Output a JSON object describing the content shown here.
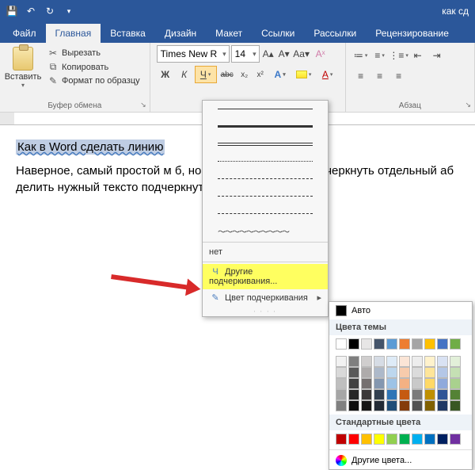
{
  "titlebar": {
    "doc_title": "как сд"
  },
  "tabs": {
    "file": "Файл",
    "home": "Главная",
    "insert": "Вставка",
    "design": "Дизайн",
    "layout": "Макет",
    "references": "Ссылки",
    "mailings": "Рассылки",
    "review": "Рецензирование"
  },
  "ribbon": {
    "clipboard": {
      "label": "Буфер обмена",
      "paste": "Вставить",
      "cut": "Вырезать",
      "copy": "Копировать",
      "format_painter": "Формат по образцу"
    },
    "font": {
      "name": "Times New R",
      "size": "14",
      "bold": "Ж",
      "italic": "К",
      "underline": "Ч",
      "strike": "abc",
      "sub": "x₂",
      "sup": "x²"
    },
    "paragraph": {
      "label": "Абзац"
    }
  },
  "document": {
    "title_sel": "Как в Word сделать линию",
    "para1": "Наверное, самый простой м                                          б, но все же включен м подчеркнуть отдельный аб                                          делить нужный тексто подчеркнутую букву ",
    "para1_end": "."
  },
  "underline_menu": {
    "none": "нет",
    "more": "Другие подчеркивания...",
    "color": "Цвет подчеркивания"
  },
  "color_panel": {
    "auto": "Авто",
    "theme": "Цвета темы",
    "standard": "Стандартные цвета",
    "more": "Другие цвета...",
    "theme_colors_row0": [
      "#ffffff",
      "#000000",
      "#e7e6e6",
      "#44546a",
      "#5b9bd5",
      "#ed7d31",
      "#a5a5a5",
      "#ffc000",
      "#4472c4",
      "#70ad47"
    ],
    "theme_colors_shades": [
      [
        "#f2f2f2",
        "#7f7f7f",
        "#d0cece",
        "#d6dce5",
        "#deebf7",
        "#fbe5d6",
        "#ededed",
        "#fff2cc",
        "#d9e2f3",
        "#e2f0d9"
      ],
      [
        "#d9d9d9",
        "#595959",
        "#aeabab",
        "#adb9ca",
        "#bdd7ee",
        "#f7cbac",
        "#dbdbdb",
        "#fee599",
        "#b4c7e7",
        "#c5e0b4"
      ],
      [
        "#bfbfbf",
        "#404040",
        "#757070",
        "#8497b0",
        "#9dc3e6",
        "#f4b183",
        "#c9c9c9",
        "#ffd966",
        "#8faadc",
        "#a9d18e"
      ],
      [
        "#a6a6a6",
        "#262626",
        "#3b3838",
        "#323f4f",
        "#2e75b6",
        "#c55a11",
        "#7b7b7b",
        "#bf9000",
        "#2f5597",
        "#548235"
      ],
      [
        "#808080",
        "#0d0d0d",
        "#171616",
        "#222a35",
        "#1f4e79",
        "#843c0c",
        "#525252",
        "#806000",
        "#203864",
        "#385723"
      ]
    ],
    "standard_colors": [
      "#c00000",
      "#ff0000",
      "#ffc000",
      "#ffff00",
      "#92d050",
      "#00b050",
      "#00b0f0",
      "#0070c0",
      "#002060",
      "#7030a0"
    ]
  }
}
